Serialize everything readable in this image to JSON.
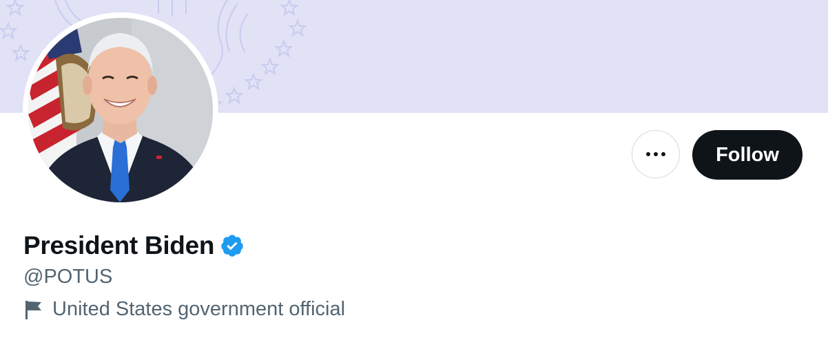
{
  "profile": {
    "display_name": "President Biden",
    "handle": "@POTUS",
    "affiliation_label": "United States government official",
    "verified": true,
    "verified_icon": "verified-badge-icon",
    "affiliation_icon": "flag-icon"
  },
  "actions": {
    "more_icon": "more-options-icon",
    "follow_label": "Follow"
  },
  "colors": {
    "banner": "#e1e2f6",
    "follow_bg": "#0f1419",
    "verified_blue": "#1d9bf0",
    "secondary_text": "#536471"
  }
}
